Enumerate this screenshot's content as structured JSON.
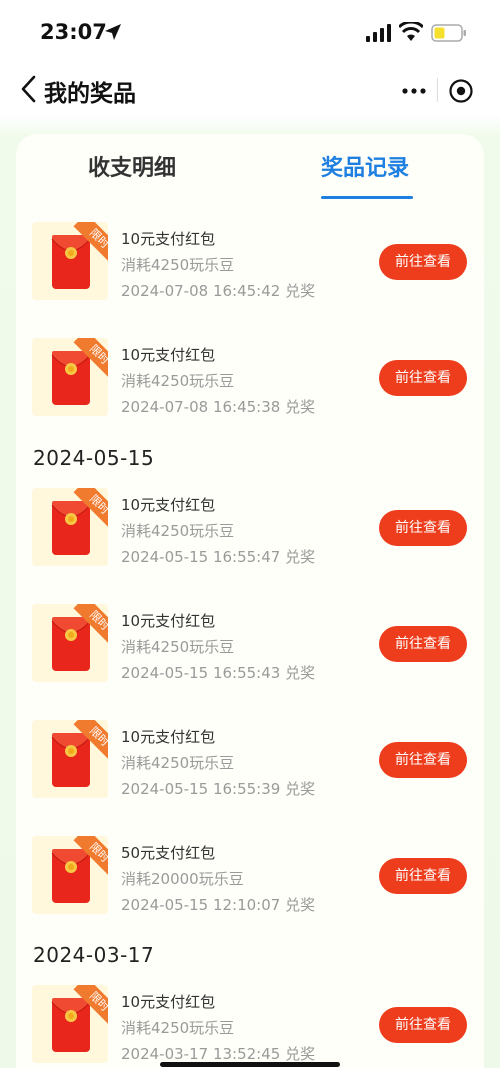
{
  "status_bar": {
    "time": "23:07"
  },
  "nav": {
    "title": "我的奖品"
  },
  "tabs": [
    {
      "label": "收支明细",
      "active": false
    },
    {
      "label": "奖品记录",
      "active": true
    }
  ],
  "badge_text": "限时",
  "action_label": "前往查看",
  "date_headers": [
    "2024-05-15",
    "2024-03-17"
  ],
  "records": [
    {
      "title": "10元支付红包",
      "cost": "消耗4250玩乐豆",
      "time": "2024-07-08 16:45:42 兑奖"
    },
    {
      "title": "10元支付红包",
      "cost": "消耗4250玩乐豆",
      "time": "2024-07-08 16:45:38 兑奖"
    },
    {
      "title": "10元支付红包",
      "cost": "消耗4250玩乐豆",
      "time": "2024-05-15 16:55:47 兑奖"
    },
    {
      "title": "10元支付红包",
      "cost": "消耗4250玩乐豆",
      "time": "2024-05-15 16:55:43 兑奖"
    },
    {
      "title": "10元支付红包",
      "cost": "消耗4250玩乐豆",
      "time": "2024-05-15 16:55:39 兑奖"
    },
    {
      "title": "50元支付红包",
      "cost": "消耗20000玩乐豆",
      "time": "2024-05-15 12:10:07 兑奖"
    },
    {
      "title": "10元支付红包",
      "cost": "消耗4250玩乐豆",
      "time": "2024-03-17 13:52:45 兑奖"
    }
  ],
  "colors": {
    "accent_blue": "#1e7fe0",
    "button_red": "#ee3d1c",
    "badge_orange": "#f07a2e",
    "background_green": "#eef9e9"
  }
}
